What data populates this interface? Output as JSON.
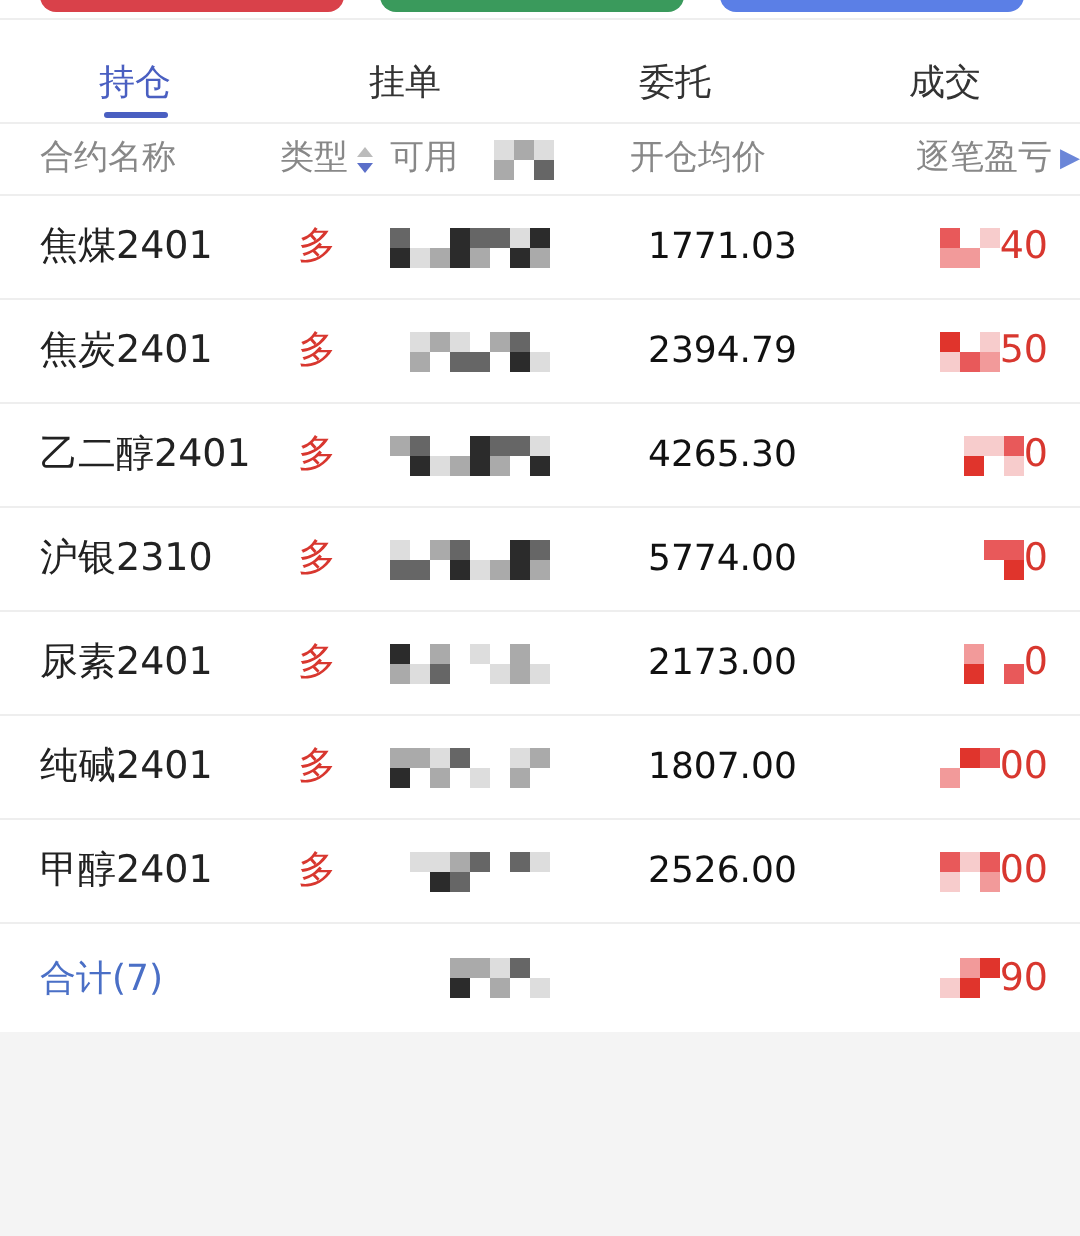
{
  "top_buttons": [
    {
      "color": "#d9414a"
    },
    {
      "color": "#3a9a5c"
    },
    {
      "color": "#5b7fe6"
    }
  ],
  "tabs": [
    {
      "label": "持仓",
      "selected": true
    },
    {
      "label": "挂单",
      "selected": false
    },
    {
      "label": "委托",
      "selected": false
    },
    {
      "label": "成交",
      "selected": false
    }
  ],
  "table": {
    "columns": [
      "合约名称",
      "类型",
      "可用",
      "开仓均价",
      "逐笔盈亏"
    ],
    "scroll_right": "▶",
    "rows": [
      {
        "name": "焦煤2401",
        "type": "多",
        "price": "1771.03",
        "pnl": "40"
      },
      {
        "name": "焦炭2401",
        "type": "多",
        "price": "2394.79",
        "pnl": "50"
      },
      {
        "name": "乙二醇2401",
        "type": "多",
        "price": "4265.30",
        "pnl": "0"
      },
      {
        "name": "沪银2310",
        "type": "多",
        "price": "5774.00",
        "pnl": "0"
      },
      {
        "name": "尿素2401",
        "type": "多",
        "price": "2173.00",
        "pnl": "0"
      },
      {
        "name": "纯碱2401",
        "type": "多",
        "price": "1807.00",
        "pnl": "00"
      },
      {
        "name": "甲醇2401",
        "type": "多",
        "price": "2526.00",
        "pnl": "00"
      }
    ],
    "total": {
      "label": "合计(7)",
      "pnl": "90"
    }
  }
}
